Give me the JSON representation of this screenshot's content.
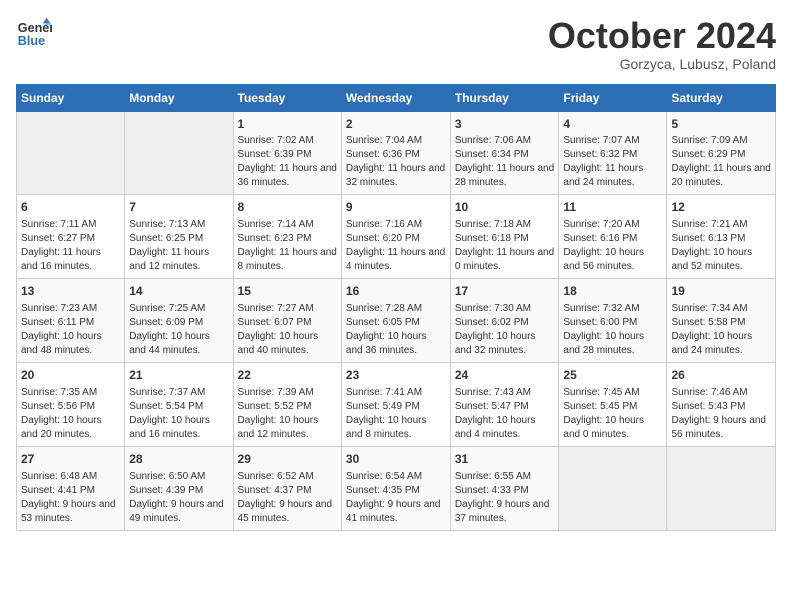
{
  "logo": {
    "line1": "General",
    "line2": "Blue"
  },
  "title": "October 2024",
  "subtitle": "Gorzyca, Lubusz, Poland",
  "days_header": [
    "Sunday",
    "Monday",
    "Tuesday",
    "Wednesday",
    "Thursday",
    "Friday",
    "Saturday"
  ],
  "weeks": [
    [
      {
        "day": "",
        "info": ""
      },
      {
        "day": "",
        "info": ""
      },
      {
        "day": "1",
        "info": "Sunrise: 7:02 AM\nSunset: 6:39 PM\nDaylight: 11 hours and 36 minutes."
      },
      {
        "day": "2",
        "info": "Sunrise: 7:04 AM\nSunset: 6:36 PM\nDaylight: 11 hours and 32 minutes."
      },
      {
        "day": "3",
        "info": "Sunrise: 7:06 AM\nSunset: 6:34 PM\nDaylight: 11 hours and 28 minutes."
      },
      {
        "day": "4",
        "info": "Sunrise: 7:07 AM\nSunset: 6:32 PM\nDaylight: 11 hours and 24 minutes."
      },
      {
        "day": "5",
        "info": "Sunrise: 7:09 AM\nSunset: 6:29 PM\nDaylight: 11 hours and 20 minutes."
      }
    ],
    [
      {
        "day": "6",
        "info": "Sunrise: 7:11 AM\nSunset: 6:27 PM\nDaylight: 11 hours and 16 minutes."
      },
      {
        "day": "7",
        "info": "Sunrise: 7:13 AM\nSunset: 6:25 PM\nDaylight: 11 hours and 12 minutes."
      },
      {
        "day": "8",
        "info": "Sunrise: 7:14 AM\nSunset: 6:23 PM\nDaylight: 11 hours and 8 minutes."
      },
      {
        "day": "9",
        "info": "Sunrise: 7:16 AM\nSunset: 6:20 PM\nDaylight: 11 hours and 4 minutes."
      },
      {
        "day": "10",
        "info": "Sunrise: 7:18 AM\nSunset: 6:18 PM\nDaylight: 11 hours and 0 minutes."
      },
      {
        "day": "11",
        "info": "Sunrise: 7:20 AM\nSunset: 6:16 PM\nDaylight: 10 hours and 56 minutes."
      },
      {
        "day": "12",
        "info": "Sunrise: 7:21 AM\nSunset: 6:13 PM\nDaylight: 10 hours and 52 minutes."
      }
    ],
    [
      {
        "day": "13",
        "info": "Sunrise: 7:23 AM\nSunset: 6:11 PM\nDaylight: 10 hours and 48 minutes."
      },
      {
        "day": "14",
        "info": "Sunrise: 7:25 AM\nSunset: 6:09 PM\nDaylight: 10 hours and 44 minutes."
      },
      {
        "day": "15",
        "info": "Sunrise: 7:27 AM\nSunset: 6:07 PM\nDaylight: 10 hours and 40 minutes."
      },
      {
        "day": "16",
        "info": "Sunrise: 7:28 AM\nSunset: 6:05 PM\nDaylight: 10 hours and 36 minutes."
      },
      {
        "day": "17",
        "info": "Sunrise: 7:30 AM\nSunset: 6:02 PM\nDaylight: 10 hours and 32 minutes."
      },
      {
        "day": "18",
        "info": "Sunrise: 7:32 AM\nSunset: 6:00 PM\nDaylight: 10 hours and 28 minutes."
      },
      {
        "day": "19",
        "info": "Sunrise: 7:34 AM\nSunset: 5:58 PM\nDaylight: 10 hours and 24 minutes."
      }
    ],
    [
      {
        "day": "20",
        "info": "Sunrise: 7:35 AM\nSunset: 5:56 PM\nDaylight: 10 hours and 20 minutes."
      },
      {
        "day": "21",
        "info": "Sunrise: 7:37 AM\nSunset: 5:54 PM\nDaylight: 10 hours and 16 minutes."
      },
      {
        "day": "22",
        "info": "Sunrise: 7:39 AM\nSunset: 5:52 PM\nDaylight: 10 hours and 12 minutes."
      },
      {
        "day": "23",
        "info": "Sunrise: 7:41 AM\nSunset: 5:49 PM\nDaylight: 10 hours and 8 minutes."
      },
      {
        "day": "24",
        "info": "Sunrise: 7:43 AM\nSunset: 5:47 PM\nDaylight: 10 hours and 4 minutes."
      },
      {
        "day": "25",
        "info": "Sunrise: 7:45 AM\nSunset: 5:45 PM\nDaylight: 10 hours and 0 minutes."
      },
      {
        "day": "26",
        "info": "Sunrise: 7:46 AM\nSunset: 5:43 PM\nDaylight: 9 hours and 56 minutes."
      }
    ],
    [
      {
        "day": "27",
        "info": "Sunrise: 6:48 AM\nSunset: 4:41 PM\nDaylight: 9 hours and 53 minutes."
      },
      {
        "day": "28",
        "info": "Sunrise: 6:50 AM\nSunset: 4:39 PM\nDaylight: 9 hours and 49 minutes."
      },
      {
        "day": "29",
        "info": "Sunrise: 6:52 AM\nSunset: 4:37 PM\nDaylight: 9 hours and 45 minutes."
      },
      {
        "day": "30",
        "info": "Sunrise: 6:54 AM\nSunset: 4:35 PM\nDaylight: 9 hours and 41 minutes."
      },
      {
        "day": "31",
        "info": "Sunrise: 6:55 AM\nSunset: 4:33 PM\nDaylight: 9 hours and 37 minutes."
      },
      {
        "day": "",
        "info": ""
      },
      {
        "day": "",
        "info": ""
      }
    ]
  ]
}
